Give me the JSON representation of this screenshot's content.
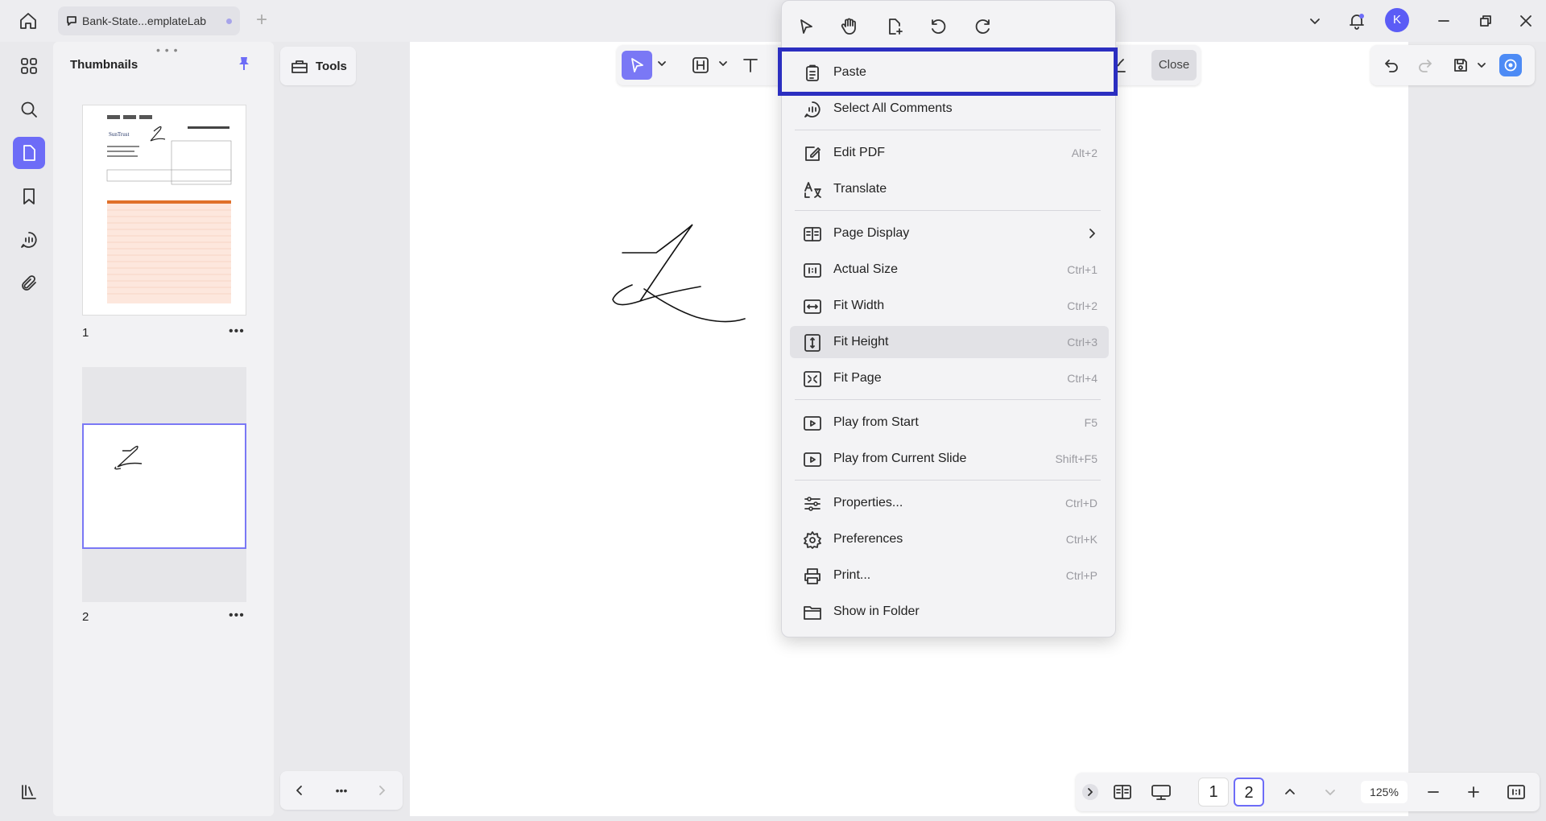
{
  "titlebar": {
    "tab_title": "Bank-State...emplateLab",
    "avatar_letter": "K"
  },
  "thumbnails": {
    "title": "Thumbnails",
    "drag_handle": "• • •",
    "pages": [
      {
        "number": "1",
        "more": "•••"
      },
      {
        "number": "2",
        "more": "•••"
      }
    ]
  },
  "tools_panel": {
    "tools_label": "Tools",
    "more": "•••"
  },
  "toolstrip": {
    "close_label": "Close"
  },
  "statusbar": {
    "pages": [
      "1",
      "2"
    ],
    "current_page": "2",
    "zoom": "125%"
  },
  "context_menu": {
    "items": [
      {
        "label": "Paste",
        "shortcut": "",
        "icon": "clipboard-icon"
      },
      {
        "label": "Select All Comments",
        "shortcut": "",
        "icon": "comments-icon"
      },
      {
        "label": "Edit PDF",
        "shortcut": "Alt+2",
        "icon": "edit-pdf-icon"
      },
      {
        "label": "Translate",
        "shortcut": "",
        "icon": "translate-icon"
      },
      {
        "label": "Page Display",
        "shortcut": "",
        "icon": "page-display-icon"
      },
      {
        "label": "Actual Size",
        "shortcut": "Ctrl+1",
        "icon": "actual-size-icon"
      },
      {
        "label": "Fit Width",
        "shortcut": "Ctrl+2",
        "icon": "fit-width-icon"
      },
      {
        "label": "Fit Height",
        "shortcut": "Ctrl+3",
        "icon": "fit-height-icon"
      },
      {
        "label": "Fit Page",
        "shortcut": "Ctrl+4",
        "icon": "fit-page-icon"
      },
      {
        "label": "Play from Start",
        "shortcut": "F5",
        "icon": "play-start-icon"
      },
      {
        "label": "Play from Current Slide",
        "shortcut": "Shift+F5",
        "icon": "play-current-icon"
      },
      {
        "label": "Properties...",
        "shortcut": "Ctrl+D",
        "icon": "properties-icon"
      },
      {
        "label": "Preferences",
        "shortcut": "Ctrl+K",
        "icon": "gear-icon"
      },
      {
        "label": "Print...",
        "shortcut": "Ctrl+P",
        "icon": "printer-icon"
      },
      {
        "label": "Show in Folder",
        "shortcut": "",
        "icon": "folder-icon"
      }
    ],
    "hovered_item": "Fit Height",
    "highlighted_item": "Paste"
  },
  "colors": {
    "accent": "#6d6cf7",
    "highlight_box": "#2b2ec0"
  }
}
